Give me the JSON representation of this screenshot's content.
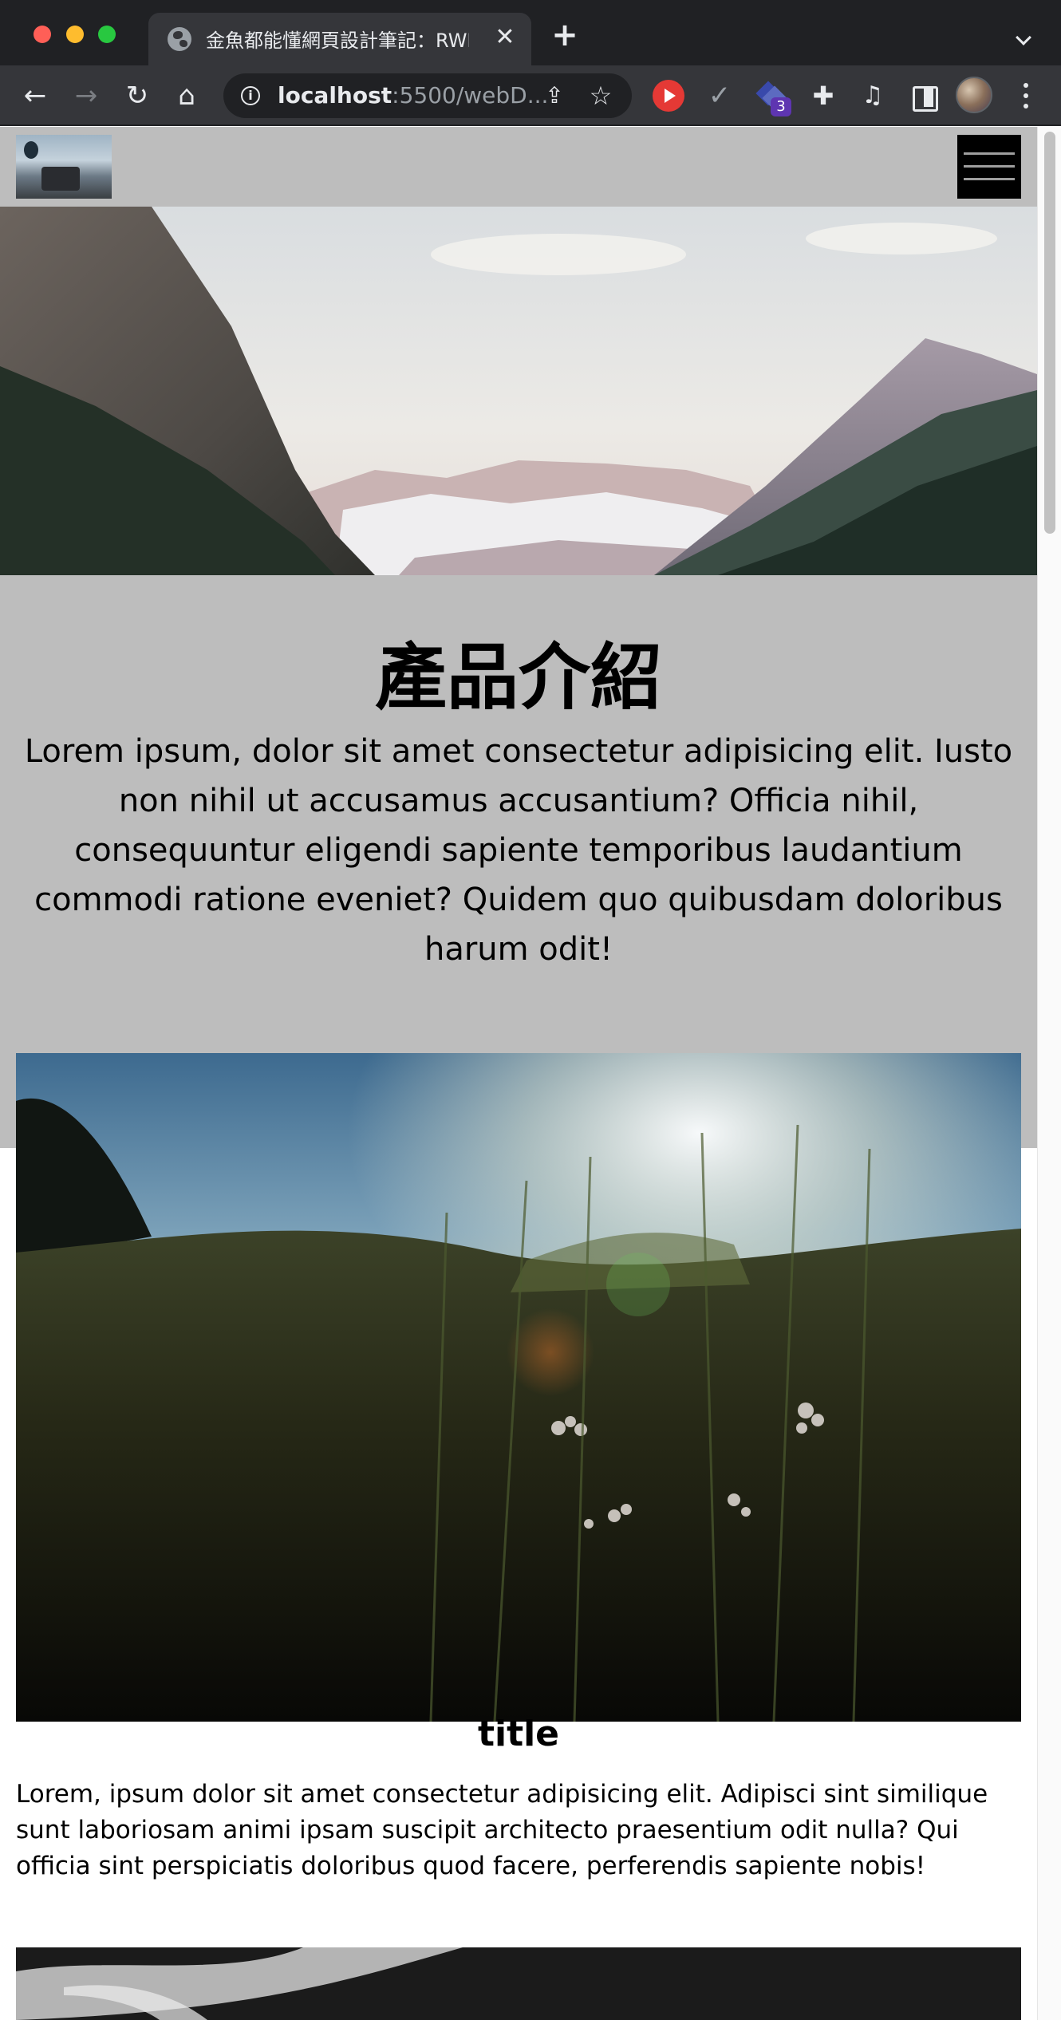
{
  "browser": {
    "tab_title": "金魚都能懂網頁設計筆記：RWD",
    "address": {
      "host": "localhost",
      "path": ":5500/webD..."
    },
    "extension_badge": "3"
  },
  "page": {
    "intro": {
      "title": "產品介紹",
      "text": "Lorem ipsum, dolor sit amet consectetur adipisicing elit. Iusto non nihil ut accusamus accusantium? Officia nihil, consequuntur eligendi sapiente temporibus laudantium commodi ratione eveniet? Quidem quo quibusdam doloribus harum odit!"
    },
    "card": {
      "title": "title",
      "text": "Lorem, ipsum dolor sit amet consectetur adipisicing elit. Adipisci sint similique sunt laboriosam animi ipsam suscipit architecto praesentium odit nulla? Qui officia sint perspiciatis doloribus quod facere, perferendis sapiente nobis!"
    }
  },
  "icons": {
    "tab_favicon": "globe-icon",
    "tab_close": "close-icon",
    "new_tab": "plus-icon",
    "back": "back-arrow-icon",
    "forward": "forward-arrow-icon",
    "reload": "reload-icon",
    "home": "home-icon",
    "site_info": "info-icon",
    "share": "share-icon",
    "bookmark": "star-icon",
    "ext_1": "play-icon",
    "ext_2": "check-icon",
    "ext_3": "stack-icon",
    "extensions": "puzzle-icon",
    "media": "media-control-icon",
    "side_panel": "side-panel-icon",
    "profile": "avatar",
    "menu": "kebab-menu-icon",
    "site_menu": "hamburger-icon"
  },
  "colors": {
    "tab_strip": "#202124",
    "toolbar": "#35363a",
    "site_header": "#bdbdbd",
    "hamburger": "#000000"
  }
}
